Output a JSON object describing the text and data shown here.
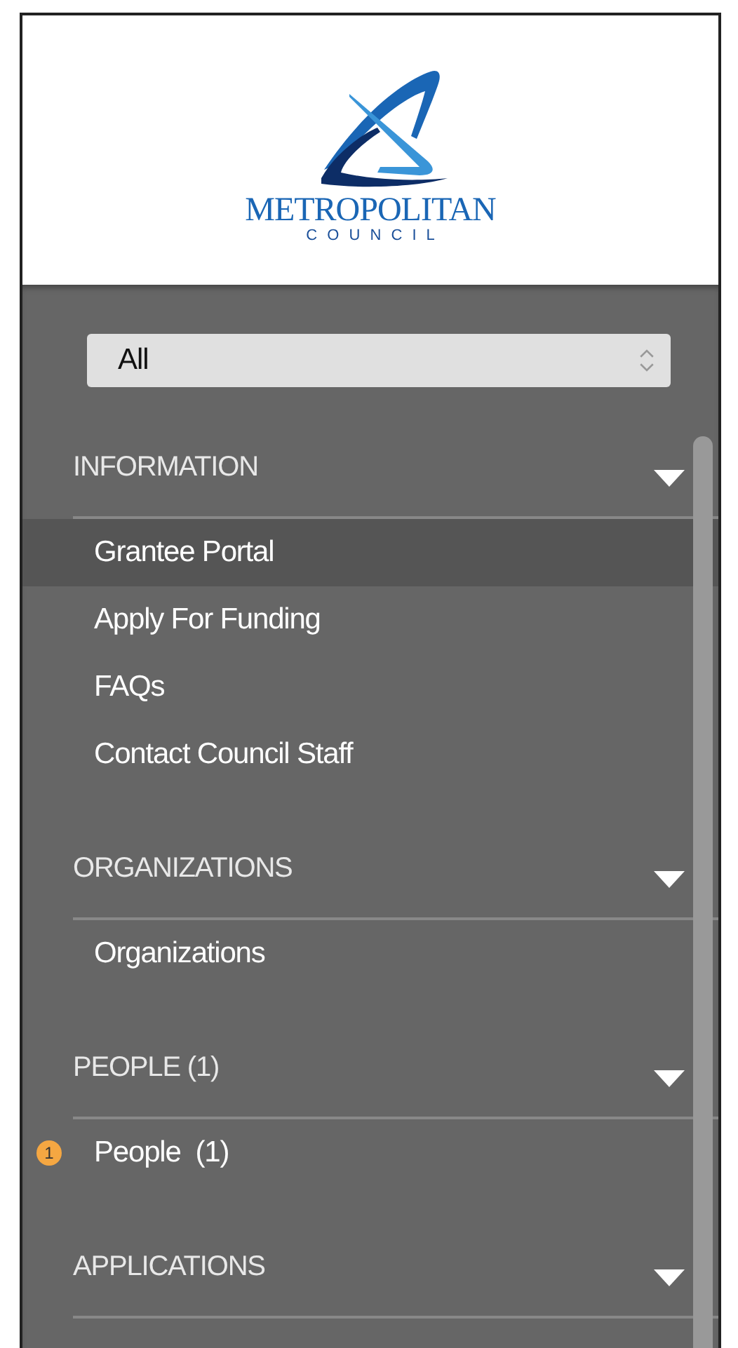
{
  "logo": {
    "name": "METROPOLITAN",
    "subtitle": "C O U N C I L"
  },
  "filter": {
    "value": "All"
  },
  "sections": [
    {
      "title": "INFORMATION",
      "items": [
        {
          "label": "Grantee Portal",
          "selected": true
        },
        {
          "label": "Apply For Funding",
          "selected": false
        },
        {
          "label": "FAQs",
          "selected": false
        },
        {
          "label": "Contact Council Staff",
          "selected": false
        }
      ]
    },
    {
      "title": "ORGANIZATIONS",
      "items": [
        {
          "label": "Organizations",
          "selected": false
        }
      ]
    },
    {
      "title": "PEOPLE (1)",
      "items": [
        {
          "label": "People  (1)",
          "selected": false,
          "badge": "1"
        }
      ]
    },
    {
      "title": "APPLICATIONS"
    }
  ]
}
